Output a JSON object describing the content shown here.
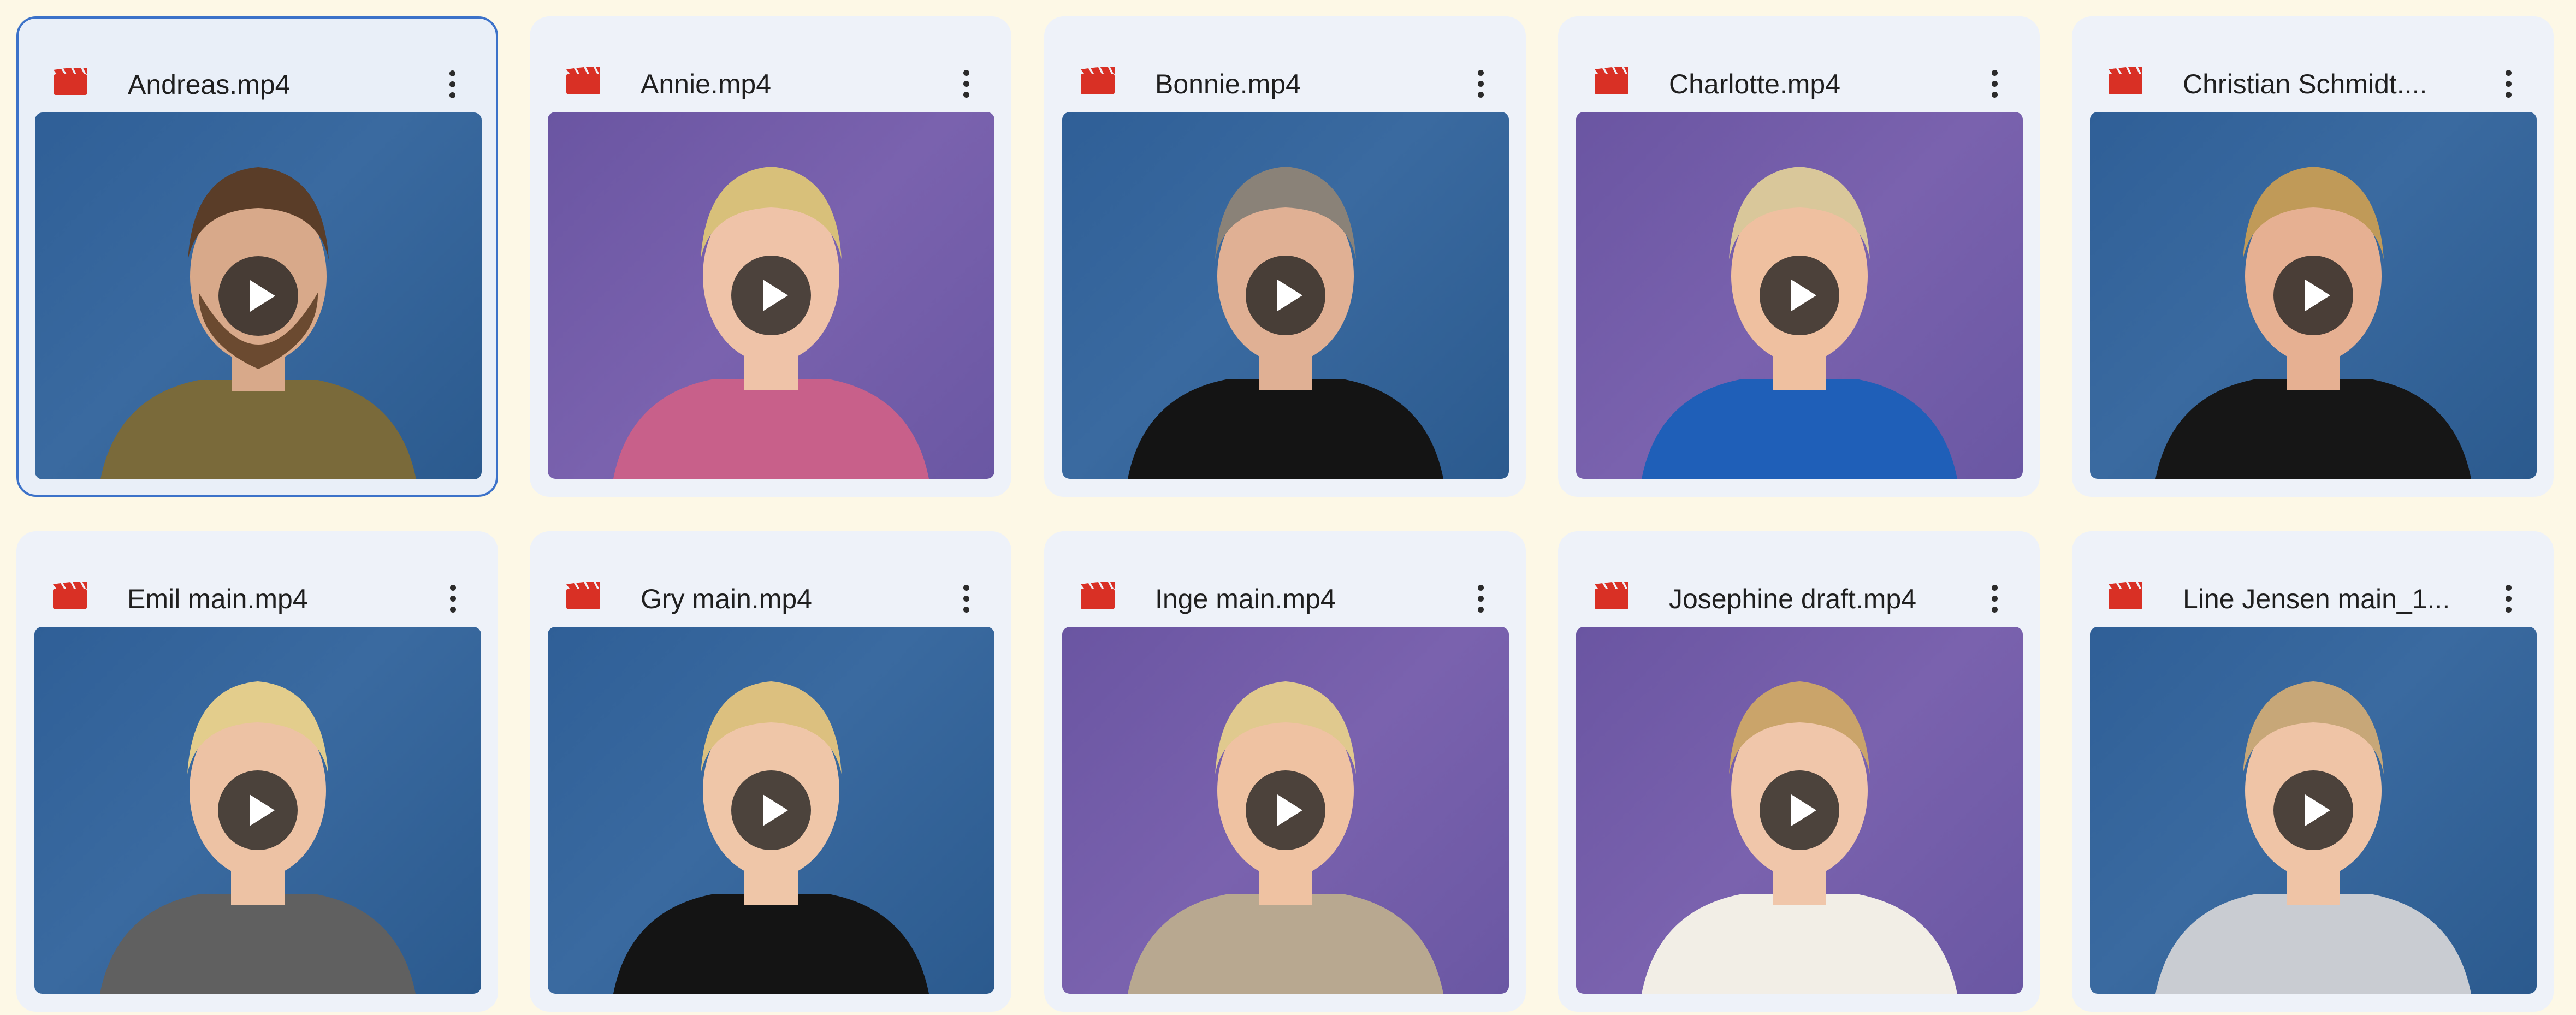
{
  "files": [
    {
      "name": "Andreas.mp4",
      "selected": true,
      "bg": "blue",
      "hair": "#5a3d28",
      "beard": true,
      "shirt": "#7a6a3a",
      "skin": "#d8a98a"
    },
    {
      "name": "Annie.mp4",
      "selected": false,
      "bg": "purple",
      "hair": "#d8c07a",
      "beard": false,
      "shirt": "#c8608a",
      "skin": "#efc3a8"
    },
    {
      "name": "Bonnie.mp4",
      "selected": false,
      "bg": "blue",
      "hair": "#8a8278",
      "beard": false,
      "shirt": "#141414",
      "skin": "#e0b094"
    },
    {
      "name": "Charlotte.mp4",
      "selected": false,
      "bg": "purple",
      "hair": "#d9c79a",
      "beard": false,
      "shirt": "#1f5fb8",
      "skin": "#efc0a0"
    },
    {
      "name": "Christian Schmidt....",
      "selected": false,
      "bg": "blue",
      "hair": "#c09a58",
      "beard": false,
      "shirt": "#161616",
      "skin": "#e6b092"
    },
    {
      "name": "Emil main.mp4",
      "selected": false,
      "bg": "blue",
      "hair": "#e3cd8c",
      "beard": false,
      "shirt": "#606060",
      "skin": "#edc2a4"
    },
    {
      "name": "Gry main.mp4",
      "selected": false,
      "bg": "blue",
      "hair": "#dcc07f",
      "beard": false,
      "shirt": "#141414",
      "skin": "#efc6a8"
    },
    {
      "name": "Inge main.mp4",
      "selected": false,
      "bg": "purple",
      "hair": "#e0c98e",
      "beard": false,
      "shirt": "#b8a890",
      "skin": "#efc2a2"
    },
    {
      "name": "Josephine draft.mp4",
      "selected": false,
      "bg": "purple",
      "hair": "#caa46a",
      "beard": false,
      "shirt": "#f2eee6",
      "skin": "#f0c6aa"
    },
    {
      "name": "Line Jensen main_1...",
      "selected": false,
      "bg": "blue",
      "hair": "#c7a778",
      "beard": false,
      "shirt": "#c9ccd2",
      "skin": "#efc4a6"
    }
  ],
  "colors": {
    "video_icon": "#d93025",
    "selected_border": "#3c72c9",
    "card_bg": "#eef2f9"
  },
  "icons": {
    "file_type": "video-clapperboard-icon",
    "more": "more-vert-icon",
    "play": "play-icon"
  }
}
